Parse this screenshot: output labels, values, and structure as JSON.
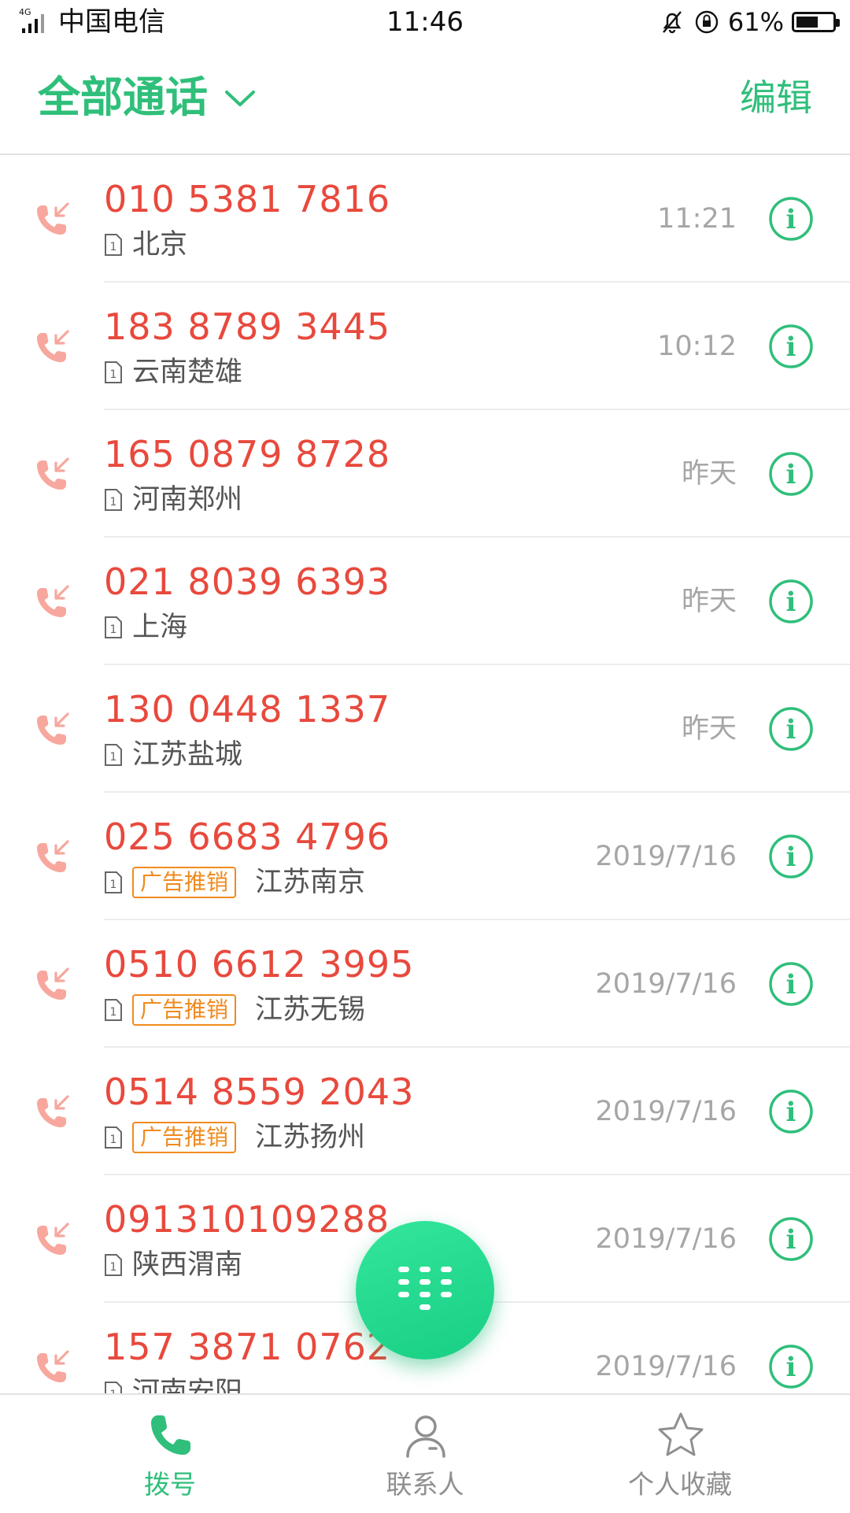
{
  "status_bar": {
    "network": "4G",
    "carrier": "中国电信",
    "time": "11:46",
    "battery_percent": "61%",
    "battery_level": 0.61
  },
  "header": {
    "title": "全部通话",
    "edit_label": "编辑"
  },
  "colors": {
    "accent": "#2fbf7a",
    "missed_number": "#e8493d",
    "tag": "#f08a1c"
  },
  "calls": [
    {
      "number": "010 5381 7816",
      "location": "北京",
      "tag": "",
      "date": "11:21"
    },
    {
      "number": "183 8789 3445",
      "location": "云南楚雄",
      "tag": "",
      "date": "10:12"
    },
    {
      "number": "165 0879 8728",
      "location": "河南郑州",
      "tag": "",
      "date": "昨天"
    },
    {
      "number": "021 8039 6393",
      "location": "上海",
      "tag": "",
      "date": "昨天"
    },
    {
      "number": "130 0448 1337",
      "location": "江苏盐城",
      "tag": "",
      "date": "昨天"
    },
    {
      "number": "025 6683 4796",
      "location": "江苏南京",
      "tag": "广告推销",
      "date": "2019/7/16"
    },
    {
      "number": "0510 6612 3995",
      "location": "江苏无锡",
      "tag": "广告推销",
      "date": "2019/7/16"
    },
    {
      "number": "0514 8559 2043",
      "location": "江苏扬州",
      "tag": "广告推销",
      "date": "2019/7/16"
    },
    {
      "number": "091310109288",
      "location": "陕西渭南",
      "tag": "",
      "date": "2019/7/16"
    },
    {
      "number": "157 3871 0762",
      "location": "河南安阳",
      "tag": "",
      "date": "2019/7/16"
    }
  ],
  "bottom_nav": {
    "dial": "拨号",
    "contacts": "联系人",
    "favorites": "个人收藏"
  },
  "icons": {
    "call_type": "missed-incoming-call-icon",
    "sim": "sim-1-icon",
    "info": "info-icon",
    "fab": "dialpad-icon"
  }
}
